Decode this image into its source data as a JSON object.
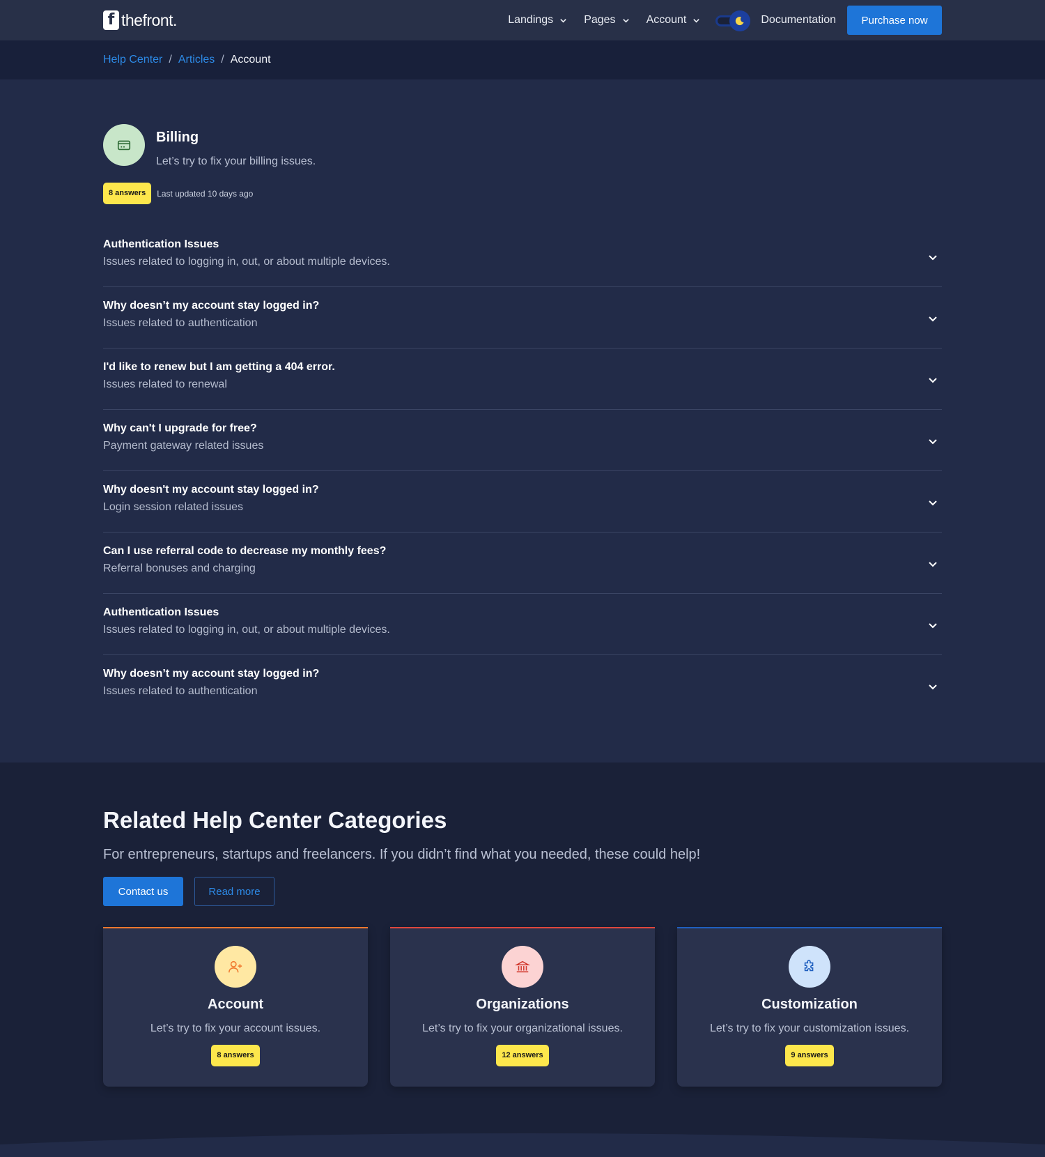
{
  "brand": {
    "logo_letter": "f",
    "logo_text": "thefront."
  },
  "nav": {
    "items": [
      {
        "label": "Landings"
      },
      {
        "label": "Pages"
      },
      {
        "label": "Account"
      }
    ],
    "documentation": "Documentation",
    "purchase": "Purchase now"
  },
  "breadcrumb": {
    "items": [
      "Help Center",
      "Articles"
    ],
    "separator": "/",
    "current": "Account"
  },
  "billing": {
    "title": "Billing",
    "subtitle": "Let’s try to fix your billing issues.",
    "answers_badge": "8 answers",
    "last_updated": "Last updated 10 days ago"
  },
  "faqs": [
    {
      "question": "Authentication Issues",
      "answer": "Issues related to logging in, out, or about multiple devices."
    },
    {
      "question": "Why doesn’t my account stay logged in?",
      "answer": "Issues related to authentication"
    },
    {
      "question": "I'd like to renew but I am getting a 404 error.",
      "answer": "Issues related to renewal"
    },
    {
      "question": "Why can't I upgrade for free?",
      "answer": "Payment gateway related issues"
    },
    {
      "question": "Why doesn't my account stay logged in?",
      "answer": "Login session related issues"
    },
    {
      "question": "Can I use referral code to decrease my monthly fees?",
      "answer": "Referral bonuses and charging"
    },
    {
      "question": "Authentication Issues",
      "answer": "Issues related to logging in, out, or about multiple devices."
    },
    {
      "question": "Why doesn’t my account stay logged in?",
      "answer": "Issues related to authentication"
    }
  ],
  "related": {
    "title": "Related Help Center Categories",
    "subtitle": "For entrepreneurs, startups and freelancers. If you didn’t find what you needed, these could help!",
    "contact_button": "Contact us",
    "read_more_button": "Read more",
    "cards": [
      {
        "title": "Account",
        "description": "Let’s try to fix your account issues.",
        "badge": "8 answers",
        "icon": "user-plus-icon",
        "accent": "#f0782e"
      },
      {
        "title": "Organizations",
        "description": "Let’s try to fix your organizational issues.",
        "badge": "12 answers",
        "icon": "bank-icon",
        "accent": "#e0473d"
      },
      {
        "title": "Customization",
        "description": "Let’s try to fix your customization issues.",
        "badge": "9 answers",
        "icon": "puzzle-icon",
        "accent": "#1f5fbf"
      }
    ]
  },
  "colors": {
    "primary": "#1e75d8",
    "badge": "#fde74c",
    "background": "#222b48"
  }
}
